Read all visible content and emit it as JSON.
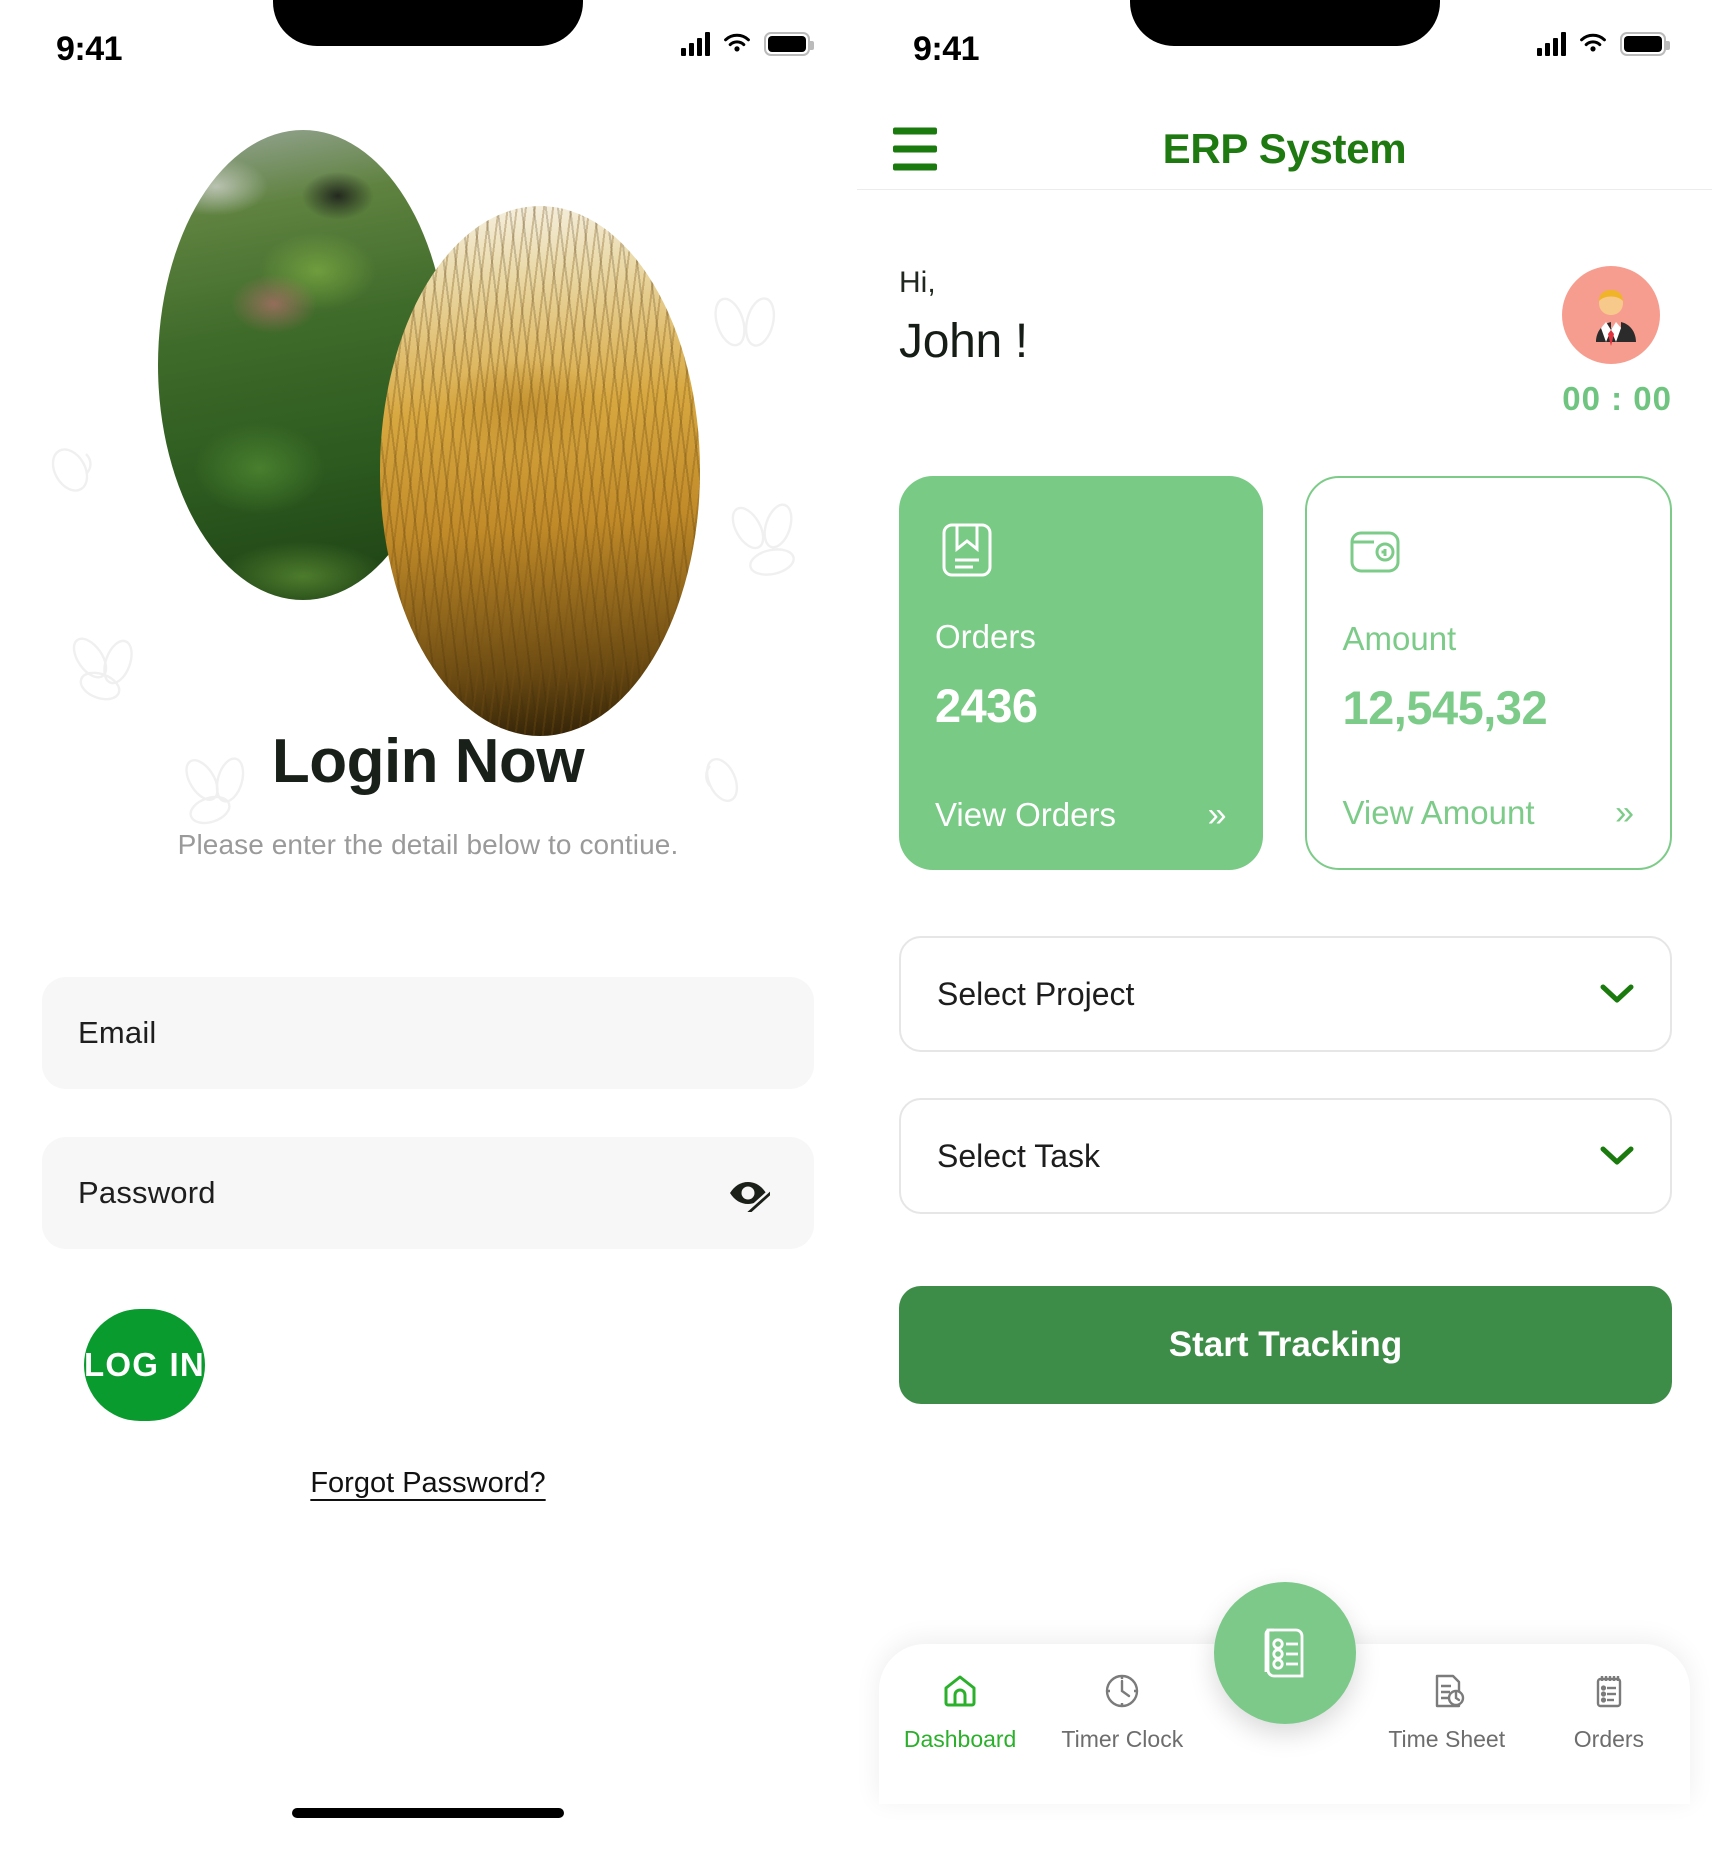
{
  "status_bar": {
    "time": "9:41",
    "signal_icon": "cellular-signal-icon",
    "wifi_icon": "wifi-icon",
    "battery_icon": "battery-icon"
  },
  "login_screen": {
    "hero": {
      "image_left_alt": "gardening-plants-photo",
      "image_right_alt": "wheat-field-photo",
      "decor_icon": "leaf-seed-outline"
    },
    "title": "Login Now",
    "subtitle": "Please enter the detail below to contiue.",
    "email_field": {
      "placeholder": "Email",
      "value": ""
    },
    "password_field": {
      "placeholder": "Password",
      "value": "",
      "toggle_icon": "eye-off-icon"
    },
    "login_button": "LOG IN",
    "forgot_link": "Forgot Password?"
  },
  "dashboard_screen": {
    "appbar": {
      "menu_icon": "hamburger-menu-icon",
      "title": "ERP System"
    },
    "greeting": {
      "hi": "Hi,",
      "name": "John !",
      "avatar_icon": "user-avatar-businessman",
      "timer": "00 : 00"
    },
    "cards": [
      {
        "icon": "book-bookmark-icon",
        "label": "Orders",
        "value": "2436",
        "action": "View Orders",
        "chevron": "»",
        "style": "filled"
      },
      {
        "icon": "wallet-icon",
        "label": "Amount",
        "value": "12,545,32",
        "action": "View Amount",
        "chevron": "»",
        "style": "outlined"
      }
    ],
    "selects": [
      {
        "label": "Select Project",
        "icon": "chevron-down-icon"
      },
      {
        "label": "Select Task",
        "icon": "chevron-down-icon"
      }
    ],
    "track_button": "Start Tracking",
    "fab": {
      "icon": "checklist-document-icon"
    },
    "tabs": [
      {
        "label": "Dashboard",
        "icon": "home-icon",
        "active": true
      },
      {
        "label": "Timer Clock",
        "icon": "clock-icon",
        "active": false
      },
      {
        "label": "Time Sheet",
        "icon": "timesheet-icon",
        "active": false
      },
      {
        "label": "Orders",
        "icon": "notepad-icon",
        "active": false
      }
    ]
  },
  "colors": {
    "brand_green": "#1e7a10",
    "login_button_green": "#0a9b2e",
    "card_green": "#78ca85",
    "track_green": "#3d8c47",
    "active_tab_green": "#2bb02b",
    "avatar_bg": "#f79d8f",
    "field_bg": "#f7f7f7"
  }
}
